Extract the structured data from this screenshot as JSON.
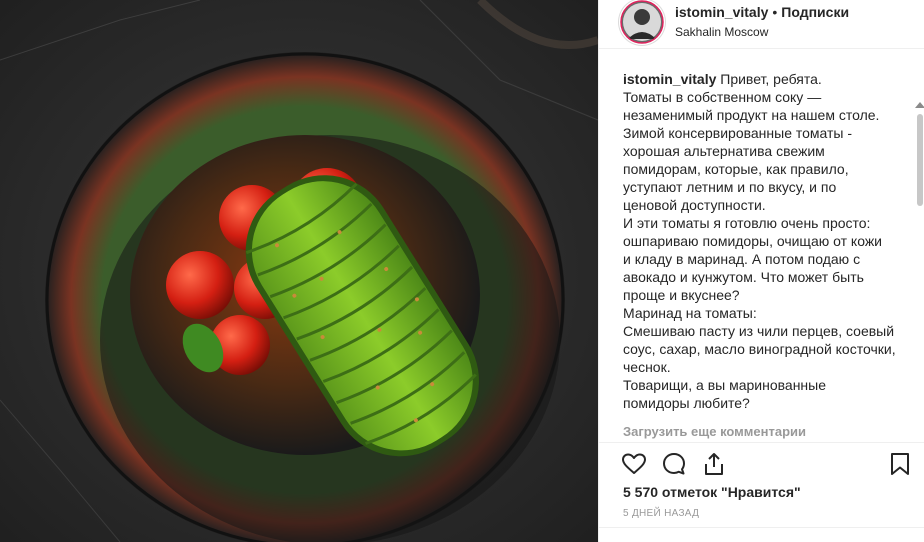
{
  "post": {
    "photo_alt": "",
    "header": {
      "username": "istomin_vitaly",
      "separator": "•",
      "follow_label": "Подписки",
      "location": "Sakhalin Moscow"
    },
    "caption": {
      "username": "istomin_vitaly",
      "first_line": "Привет, ребята.",
      "lines": [
        "Томаты в собственном соку —",
        "незаменимый продукт на нашем столе.",
        "Зимой консервированные томаты -",
        "хорошая альтернатива свежим",
        "помидорам, которые, как правило,",
        "уступают летним и по вкусу, и по",
        "ценовой доступности.",
        "И эти томаты я готовлю очень просто:",
        "ошпариваю помидоры, очищаю от кожи",
        "и кладу в маринад. А потом подаю с",
        "авокадо и кунжутом. Что может быть",
        "проще и вкуснее?",
        "Маринад на томаты:",
        "Смешиваю пасту из чили перцев, соевый",
        "соус, сахар, масло виноградной косточки,",
        "чеснок.",
        "Товарищи, а вы маринованные",
        "помидоры любите?"
      ]
    },
    "load_more_label": "Загрузить еще комментарии",
    "likes_label": "5 570 отметок \"Нравится\"",
    "time_label": "5 ДНЕЙ НАЗАД",
    "icons": {
      "like": "heart-icon",
      "comment": "comment-icon",
      "share": "share-icon",
      "save": "bookmark-icon"
    }
  }
}
